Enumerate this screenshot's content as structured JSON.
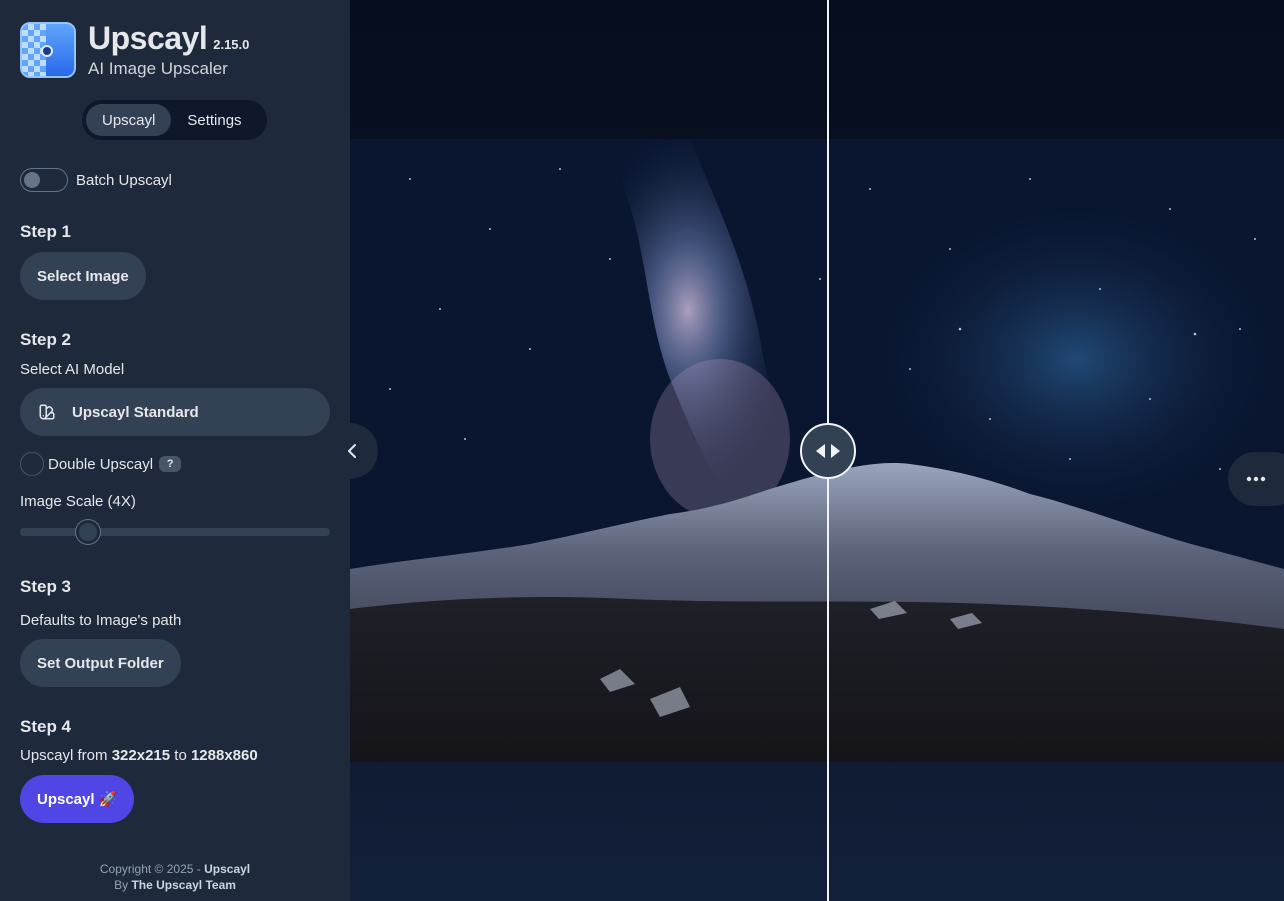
{
  "app": {
    "name": "Upscayl",
    "version": "2.15.0",
    "subtitle": "AI Image Upscaler"
  },
  "tabs": [
    {
      "label": "Upscayl",
      "active": true
    },
    {
      "label": "Settings",
      "active": false
    }
  ],
  "batch": {
    "label": "Batch Upscayl",
    "enabled": false
  },
  "step1": {
    "title": "Step 1",
    "button": "Select Image"
  },
  "step2": {
    "title": "Step 2",
    "model_label": "Select AI Model",
    "model_value": "Upscayl Standard",
    "double_label": "Double Upscayl",
    "double_checked": false,
    "help": "?",
    "scale_label": "Image Scale (4X)",
    "scale_fraction": 0.22
  },
  "step3": {
    "title": "Step 3",
    "hint": "Defaults to Image's path",
    "button": "Set Output Folder"
  },
  "step4": {
    "title": "Step 4",
    "prefix": "Upscayl from",
    "from": "322x215",
    "to_word": "to",
    "to": "1288x860",
    "button": "Upscayl 🚀"
  },
  "footer": {
    "copyright": "Copyright © 2025 -",
    "brand": "Upscayl",
    "by": "By",
    "team": "The Upscayl Team"
  },
  "compare": {
    "position_fraction": 0.512
  },
  "colors": {
    "sidebar": "#1e293b",
    "accent": "#4f46e5",
    "button": "#334155"
  }
}
